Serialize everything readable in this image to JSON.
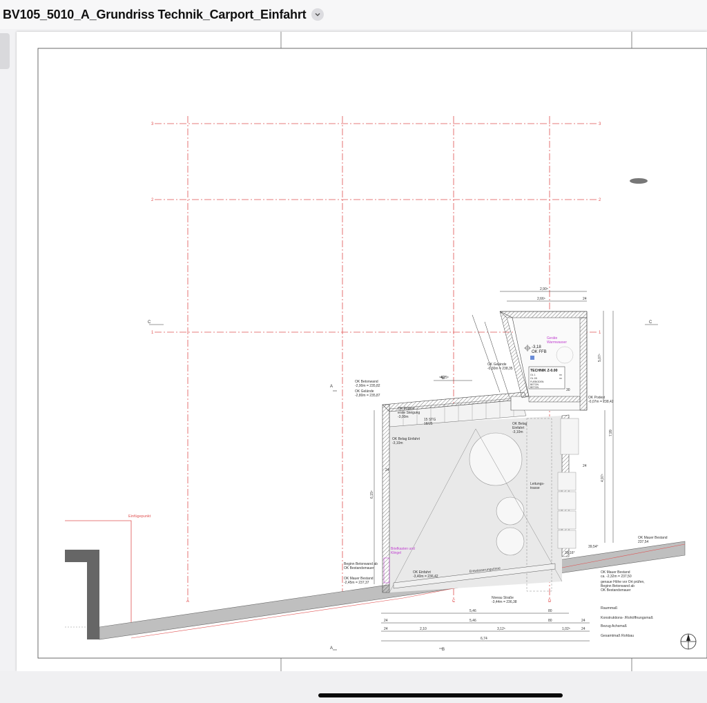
{
  "window": {
    "title": "BV105_5010_A_Grundriss Technik_Carport_Einfahrt"
  },
  "icons": {
    "title_menu": "chevron-down-icon",
    "north_arrow": "north-arrow-icon"
  },
  "plan": {
    "room": {
      "name": "TECHNIK Z-0.00",
      "level_value": "-3,18",
      "level_label": "OK FFB",
      "table_rows": [
        [
          "OL 1",
          "",
          "m²"
        ],
        [
          "OL 1B",
          "",
          "m²"
        ],
        [
          "FUEBODEN",
          "",
          ""
        ],
        [
          "BETON",
          "",
          ""
        ],
        [
          "BETON",
          "",
          ""
        ]
      ]
    },
    "axes": {
      "rows": [
        "3",
        "2",
        "1"
      ],
      "columns": [
        "A",
        "B",
        "C",
        "D"
      ],
      "section_marks": [
        "C",
        "C",
        "A",
        "A",
        "B",
        "B"
      ]
    },
    "labels": {
      "einfuegepunkt": "Einfügepunkt",
      "gerate": "Geräte",
      "gerate2": "Warmwasser",
      "ok_betonwand": "OK Betonwand",
      "ok_betonwand_val": "-2,90m = 235,82",
      "ok_gelaende_left": "OK Gelände",
      "ok_gelaende_left_val": "-2,80m = 235,87",
      "ok_gelaende_top": "OK Gelände",
      "ok_gelaende_top_val": "-0,30m = 238,35",
      "ok_podest_left": "OK Podest",
      "ok_podest_left_2": "erste Steigung",
      "ok_podest_left_3": "-3,00m",
      "stg": "15 STG",
      "stg_val": "18/25",
      "ok_belag_einfahrt": "OK Belag Einfahrt",
      "ok_belag_einfahrt_val": "-3,10m",
      "ok_belag": "OK Belag",
      "ok_belag_2": "Einfahrt",
      "ok_belag_3": "-3,10m",
      "ok_podest_right": "OK Podest",
      "ok_podest_right_val": "-0,07m = 238,42",
      "leitungs": "Leitungs-",
      "leitungs2": "trasse",
      "briefkasten": "Briefkasten und",
      "briefkasten2": "Klingel",
      "beginn": "Beginn Betonwand ab",
      "beginn2": "OK Bestandsmauer",
      "ok_mauer_left": "OK Mauer Bestand",
      "ok_mauer_left_val": "-2,45m = 237,37",
      "ok_einfahrt": "OK Einfahrt",
      "ok_einfahrt_val": "-3,40m = 236,42",
      "entwaesserung": "Entwässerungsrinne",
      "niveau": "Niveau Straße",
      "niveau_val": "-3,44m = 236,38",
      "ok_mauer_right": "OK Mauer Bestand",
      "ok_mauer_right_val": "237,54",
      "ok_mauer_right2": "OK Mauer Bestand",
      "ok_mauer_right2_val": "ca. -2,32m = 237,50",
      "genaue": "genaue Höhe vor Ort prüfen,",
      "genaue2": "Beginn Betonwand ab",
      "genaue3": "OK Bestandsmauer",
      "v3954": "39,54°",
      "v3916": "39,16°"
    },
    "dimension_legend": [
      "Raummaß",
      "Konstruktions- /Rohöffnungsmaß",
      "Bezug Achsmaß",
      "Gesamtmaß Rohbau"
    ],
    "dimensions": {
      "top1": "2,90⁵",
      "top2": "2,66⁵",
      "top24": "24",
      "h1": "5,07⁵",
      "h2": "7,99",
      "h3": "4,97⁵",
      "h4": "6,15⁵",
      "r1": "5,46",
      "r1b": "80",
      "r2a": "24",
      "r2b": "5,46",
      "r2c": "80",
      "r2d": "24",
      "r3a": "24",
      "r3b": "2,10",
      "r3c": "3,12⁵",
      "r3d": "1,02⁵",
      "r3e": "24",
      "r4": "6,74",
      "small24a": "24",
      "small24b": "24",
      "d425": "4,25⁵",
      "d30": "30"
    }
  }
}
